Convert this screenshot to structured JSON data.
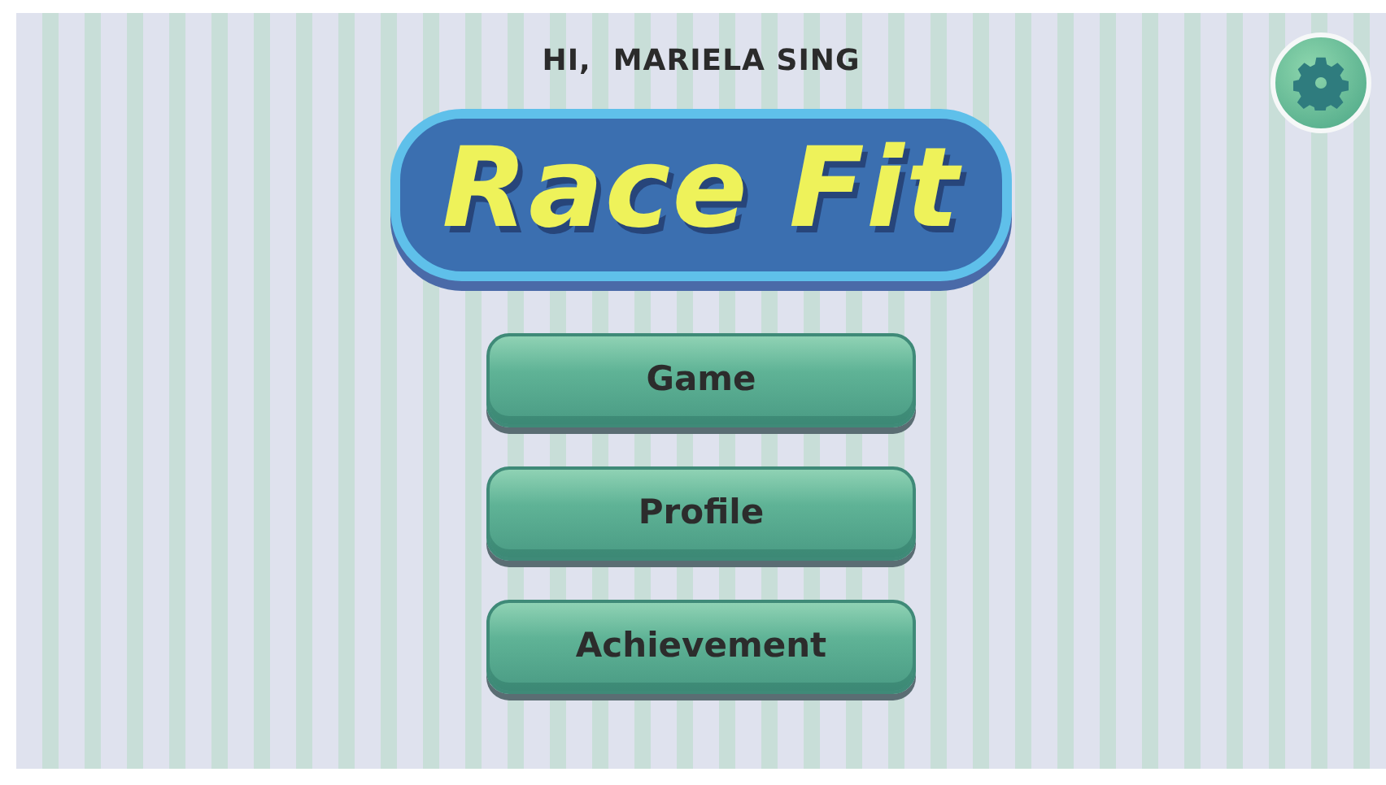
{
  "greeting": "HI,  MARIELA SING",
  "logo": "Race Fit",
  "menu": [
    {
      "label": "Game"
    },
    {
      "label": "Profile"
    },
    {
      "label": "Achievement"
    }
  ]
}
